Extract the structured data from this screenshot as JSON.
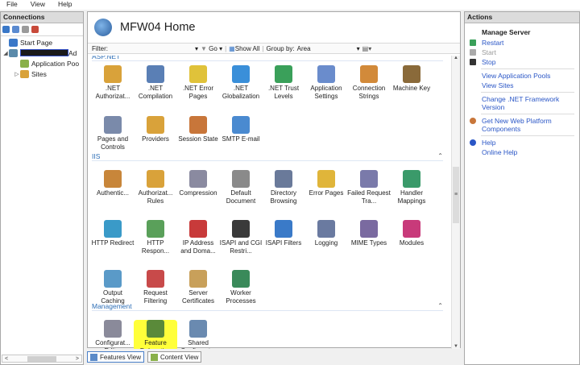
{
  "menu": [
    "File",
    "View",
    "Help"
  ],
  "connections": {
    "title": "Connections",
    "tree": [
      {
        "label": "Start Page",
        "level": 0,
        "icon": "start-page-icon"
      },
      {
        "label": "",
        "level": 0,
        "icon": "server-icon",
        "redacted": true,
        "suffix": "Ad"
      },
      {
        "label": "Application Poo",
        "level": 1,
        "icon": "app-pool-icon"
      },
      {
        "label": "Sites",
        "level": 1,
        "icon": "sites-folder-icon"
      }
    ],
    "scroll_left": "<",
    "scroll_right": ">",
    "scroll_thumb": "III"
  },
  "main": {
    "title": "MFW04 Home",
    "filter_label": "Filter:",
    "go_label": "Go",
    "show_all": "Show All",
    "group_by_label": "Group by:",
    "group_by_value": "Area",
    "sections": [
      {
        "name": "ASP.NET",
        "tiles": [
          {
            "label": ".NET Authorizat...",
            "icon": "dotnet-authorization-icon",
            "color": "#d9a23a"
          },
          {
            "label": ".NET Compilation",
            "icon": "dotnet-compilation-icon",
            "color": "#5a7fb5"
          },
          {
            "label": ".NET Error Pages",
            "icon": "dotnet-error-pages-icon",
            "color": "#e0c23a"
          },
          {
            "label": ".NET Globalization",
            "icon": "dotnet-globalization-icon",
            "color": "#3a8fd9"
          },
          {
            "label": ".NET Trust Levels",
            "icon": "dotnet-trust-levels-icon",
            "color": "#3aa05a"
          },
          {
            "label": "Application Settings",
            "icon": "application-settings-icon",
            "color": "#6a8ccc"
          },
          {
            "label": "Connection Strings",
            "icon": "connection-strings-icon",
            "color": "#d28a3a"
          },
          {
            "label": "Machine Key",
            "icon": "machine-key-icon",
            "color": "#8a6a3a"
          },
          {
            "label": "Pages and Controls",
            "icon": "pages-controls-icon",
            "color": "#7a8aaa"
          },
          {
            "label": "Providers",
            "icon": "providers-icon",
            "color": "#d9a23a"
          },
          {
            "label": "Session State",
            "icon": "session-state-icon",
            "color": "#c8763a"
          },
          {
            "label": "SMTP E-mail",
            "icon": "smtp-email-icon",
            "color": "#4a8ad0"
          }
        ]
      },
      {
        "name": "IIS",
        "tiles": [
          {
            "label": "Authentic...",
            "icon": "authentication-icon",
            "color": "#c8863a"
          },
          {
            "label": "Authorizat... Rules",
            "icon": "authorization-rules-icon",
            "color": "#d9a23a"
          },
          {
            "label": "Compression",
            "icon": "compression-icon",
            "color": "#8a8aa0"
          },
          {
            "label": "Default Document",
            "icon": "default-document-icon",
            "color": "#8a8a8a"
          },
          {
            "label": "Directory Browsing",
            "icon": "directory-browsing-icon",
            "color": "#6a7a9a"
          },
          {
            "label": "Error Pages",
            "icon": "error-pages-icon",
            "color": "#e0b53a"
          },
          {
            "label": "Failed Request Tra...",
            "icon": "failed-request-tracing-icon",
            "color": "#7a7aaa"
          },
          {
            "label": "Handler Mappings",
            "icon": "handler-mappings-icon",
            "color": "#3a9a6a"
          },
          {
            "label": "HTTP Redirect",
            "icon": "http-redirect-icon",
            "color": "#3a9ac8"
          },
          {
            "label": "HTTP Respon...",
            "icon": "http-response-headers-icon",
            "color": "#5aa05a"
          },
          {
            "label": "IP Address and Doma...",
            "icon": "ip-address-domain-icon",
            "color": "#c83a3a"
          },
          {
            "label": "ISAPI and CGI Restri...",
            "icon": "isapi-cgi-restrictions-icon",
            "color": "#3a3a3a"
          },
          {
            "label": "ISAPI Filters",
            "icon": "isapi-filters-icon",
            "color": "#3a7ac8"
          },
          {
            "label": "Logging",
            "icon": "logging-icon",
            "color": "#6a7aa0"
          },
          {
            "label": "MIME Types",
            "icon": "mime-types-icon",
            "color": "#7a6aa0"
          },
          {
            "label": "Modules",
            "icon": "modules-icon",
            "color": "#c83a7a"
          },
          {
            "label": "Output Caching",
            "icon": "output-caching-icon",
            "color": "#5a9ac8"
          },
          {
            "label": "Request Filtering",
            "icon": "request-filtering-icon",
            "color": "#c84a4a"
          },
          {
            "label": "Server Certificates",
            "icon": "server-certificates-icon",
            "color": "#c8a05a"
          },
          {
            "label": "Worker Processes",
            "icon": "worker-processes-icon",
            "color": "#3a8a5a"
          }
        ]
      },
      {
        "name": "Management",
        "tiles": [
          {
            "label": "Configurat... Editor",
            "icon": "configuration-editor-icon",
            "color": "#8a8a9a"
          },
          {
            "label": "Feature Delegation",
            "icon": "feature-delegation-icon",
            "color": "#5a8a3a",
            "highlight": true
          },
          {
            "label": "Shared Configurat...",
            "icon": "shared-configuration-icon",
            "color": "#6a8ab0"
          }
        ]
      }
    ],
    "tabs": [
      {
        "label": "Features View",
        "selected": true,
        "icon": "features-view-icon"
      },
      {
        "label": "Content View",
        "selected": false,
        "icon": "content-view-icon"
      }
    ]
  },
  "actions": {
    "title": "Actions",
    "groups": [
      {
        "header": "Manage Server",
        "items": [
          {
            "label": "Restart",
            "icon": "restart-icon",
            "enabled": true
          },
          {
            "label": "Start",
            "icon": "start-icon",
            "enabled": false
          },
          {
            "label": "Stop",
            "icon": "stop-icon",
            "enabled": true
          }
        ]
      },
      {
        "header": "",
        "items": [
          {
            "label": "View Application Pools",
            "enabled": true
          },
          {
            "label": "View Sites",
            "enabled": true
          }
        ]
      },
      {
        "header": "",
        "items": [
          {
            "label": "Change .NET Framework Version",
            "enabled": true
          }
        ]
      },
      {
        "header": "",
        "items": [
          {
            "label": "Get New Web Platform Components",
            "icon": "web-platform-icon",
            "enabled": true
          }
        ]
      },
      {
        "header": "",
        "items": [
          {
            "label": "Help",
            "icon": "help-icon",
            "enabled": true
          },
          {
            "label": "Online Help",
            "enabled": true
          }
        ]
      }
    ]
  }
}
